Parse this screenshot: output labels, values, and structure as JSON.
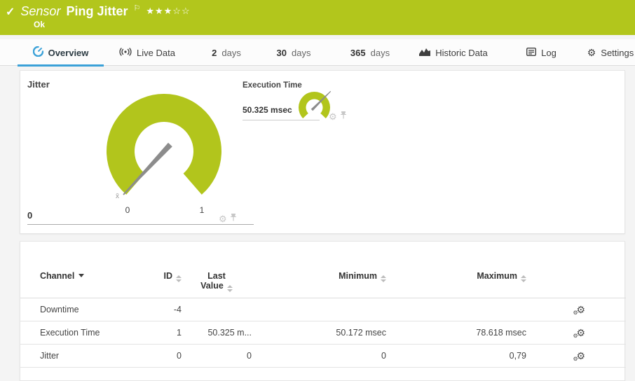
{
  "header": {
    "status_icon": "✓",
    "type_label": "Sensor",
    "title": "Ping Jitter",
    "flag": "⚐",
    "stars": "★★★☆☆",
    "status": "Ok"
  },
  "tabs": {
    "overview": {
      "label": "Overview"
    },
    "live": {
      "label": "Live Data"
    },
    "d2": {
      "num": "2",
      "unit": "days"
    },
    "d30": {
      "num": "30",
      "unit": "days"
    },
    "d365": {
      "num": "365",
      "unit": "days"
    },
    "historic": {
      "label": "Historic Data"
    },
    "log": {
      "label": "Log"
    },
    "settings": {
      "label": "Settings"
    }
  },
  "gauges": {
    "jitter": {
      "title": "Jitter",
      "value": "0",
      "scale_min": "0",
      "scale_max": "1",
      "avg_marker": "x̄"
    },
    "execution": {
      "title": "Execution Time",
      "value": "50.325 msec"
    }
  },
  "table": {
    "headers": {
      "channel": "Channel",
      "id": "ID",
      "last_line1": "Last",
      "last_line2": "Value",
      "min": "Minimum",
      "max": "Maximum"
    },
    "rows": [
      {
        "channel": "Downtime",
        "id": "-4",
        "last": "",
        "min": "",
        "max": ""
      },
      {
        "channel": "Execution Time",
        "id": "1",
        "last": "50.325 m...",
        "min": "50.172 msec",
        "max": "78.618 msec"
      },
      {
        "channel": "Jitter",
        "id": "0",
        "last": "0",
        "min": "0",
        "max": "0,79"
      }
    ]
  },
  "colors": {
    "brand_green": "#b2c61c",
    "accent_blue": "#3aa1d8"
  }
}
